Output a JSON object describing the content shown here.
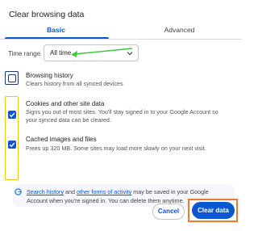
{
  "dialog": {
    "title": "Clear browsing data",
    "tabs": [
      {
        "label": "Basic"
      },
      {
        "label": "Advanced"
      }
    ],
    "time_range": {
      "label": "Time range",
      "value": "All time"
    },
    "items": [
      {
        "title": "Browsing history",
        "description": "Clears history from all synced devices",
        "checked": false
      },
      {
        "title": "Cookies and other site data",
        "description_line1": "Signs you out of most sites. You'll stay signed in to your Google Account so",
        "description_line2": "your synced data can be cleared.",
        "checked": true
      },
      {
        "title": "Cached images and files",
        "description": "Frees up 320 MB. Some sites may load more slowly on your next visit.",
        "checked": true
      }
    ],
    "info": {
      "link1": "Search history",
      "mid1": " and ",
      "link2": "other forms of activity",
      "mid2": " may be saved in your Google",
      "line2": "Account when you're signed in. You can delete them anytime."
    },
    "buttons": {
      "cancel": "Cancel",
      "clear": "Clear data"
    }
  },
  "colors": {
    "accent": "#0b57d0",
    "annotation_arrow": "#3ec93e",
    "annotation_yellow": "#f5c518",
    "annotation_orange": "#f07a2d"
  }
}
